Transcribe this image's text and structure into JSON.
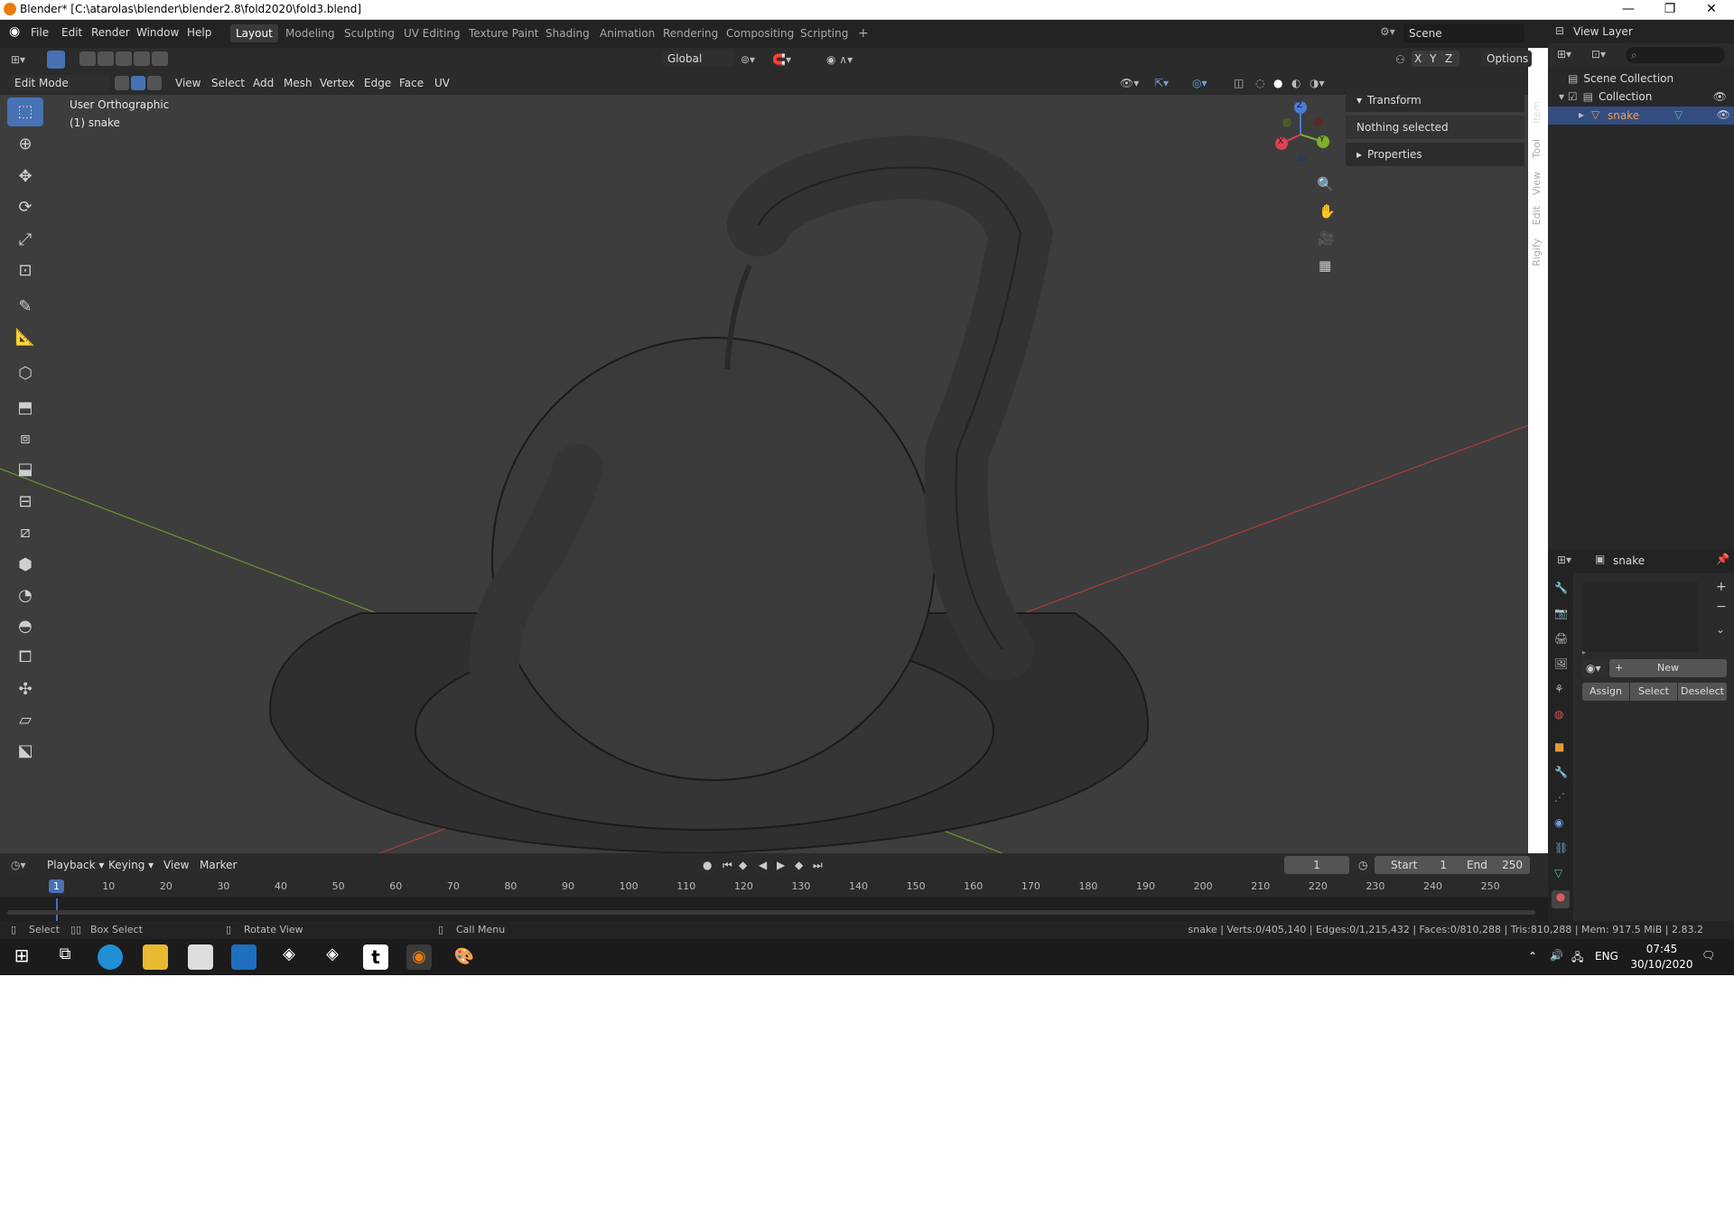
{
  "window": {
    "title": "Blender* [C:\\atarolas\\blender\\blender2.8\\fold2020\\fold3.blend]",
    "minimize": "—",
    "restore": "❐",
    "close": "✕"
  },
  "menu": [
    "File",
    "Edit",
    "Render",
    "Window",
    "Help"
  ],
  "workspaces": [
    "Layout",
    "Modeling",
    "Sculpting",
    "UV Editing",
    "Texture Paint",
    "Shading",
    "Animation",
    "Rendering",
    "Compositing",
    "Scripting"
  ],
  "workspace_add": "+",
  "scene": {
    "name": "Scene",
    "view_layer": "View Layer"
  },
  "header1": {
    "orientation": "Global",
    "axes": [
      "X",
      "Y",
      "Z"
    ],
    "options": "Options"
  },
  "header2": {
    "mode": "Edit Mode",
    "menus": [
      "View",
      "Select",
      "Add",
      "Mesh",
      "Vertex",
      "Edge",
      "Face",
      "UV"
    ]
  },
  "viewport": {
    "view_name": "User Orthographic",
    "object_label": "(1) snake",
    "gizmo": {
      "x": "X",
      "y": "Y",
      "z": "Z"
    },
    "colors": {
      "x_axis": "#b03a3a",
      "y_axis": "#6b9a2e",
      "bg": "#3d3d3d"
    }
  },
  "npanel": {
    "transform": "Transform",
    "nothing_selected": "Nothing selected",
    "properties": "Properties",
    "tabs": [
      "Item",
      "Tool",
      "View",
      "Edit",
      "Rigify"
    ]
  },
  "outliner": {
    "scene_collection": "Scene Collection",
    "collection": "Collection",
    "object": "snake"
  },
  "properties": {
    "object": "snake",
    "new": "New",
    "assign": "Assign",
    "select": "Select",
    "deselect": "Deselect"
  },
  "timeline": {
    "menus": [
      "Playback",
      "Keying",
      "View",
      "Marker"
    ],
    "current_frame": "1",
    "start_label": "Start",
    "start": "1",
    "end_label": "End",
    "end": "250",
    "ticks": [
      "1",
      "10",
      "20",
      "30",
      "40",
      "50",
      "60",
      "70",
      "80",
      "90",
      "100",
      "110",
      "120",
      "130",
      "140",
      "150",
      "160",
      "170",
      "180",
      "190",
      "200",
      "210",
      "220",
      "230",
      "240",
      "250"
    ]
  },
  "status": {
    "select": "Select",
    "box_select": "Box Select",
    "rotate_view": "Rotate View",
    "call_menu": "Call Menu",
    "stats": "snake | Verts:0/405,140 | Edges:0/1,215,432 | Faces:0/810,288 | Tris:810,288 | Mem: 917.5 MiB | 2.83.2"
  },
  "taskbar": {
    "lang": "ENG",
    "time": "07:45",
    "date": "30/10/2020"
  }
}
